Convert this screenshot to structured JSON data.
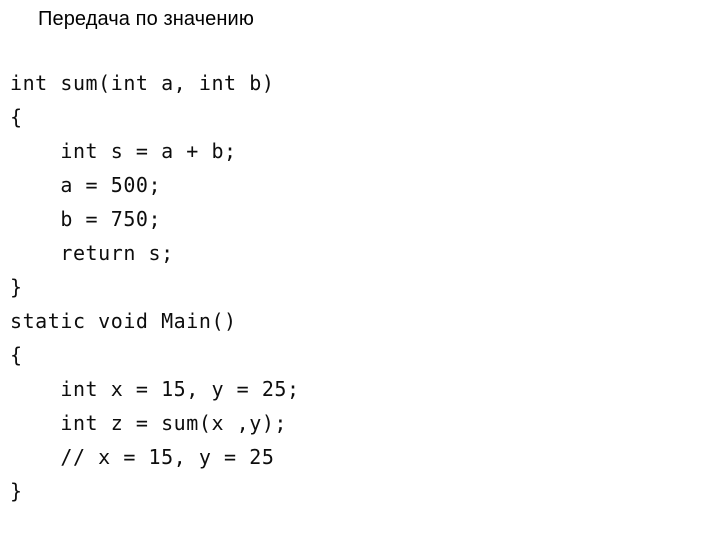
{
  "slide": {
    "title": "Передача по значению",
    "background_color": "#ffffff",
    "text_color": "#000000",
    "code_color": "#0d0d0d"
  },
  "code": {
    "language": "csharp",
    "indent_spaces": 4,
    "lines": [
      "int sum(int a, int b)",
      "{",
      "    int s = a + b;",
      "    a = 500;",
      "    b = 750;",
      "    return s;",
      "}",
      "static void Main()",
      "{",
      "    int x = 15, y = 25;",
      "    int z = sum(x ,y);",
      "    // x = 15, y = 25",
      "}"
    ]
  }
}
